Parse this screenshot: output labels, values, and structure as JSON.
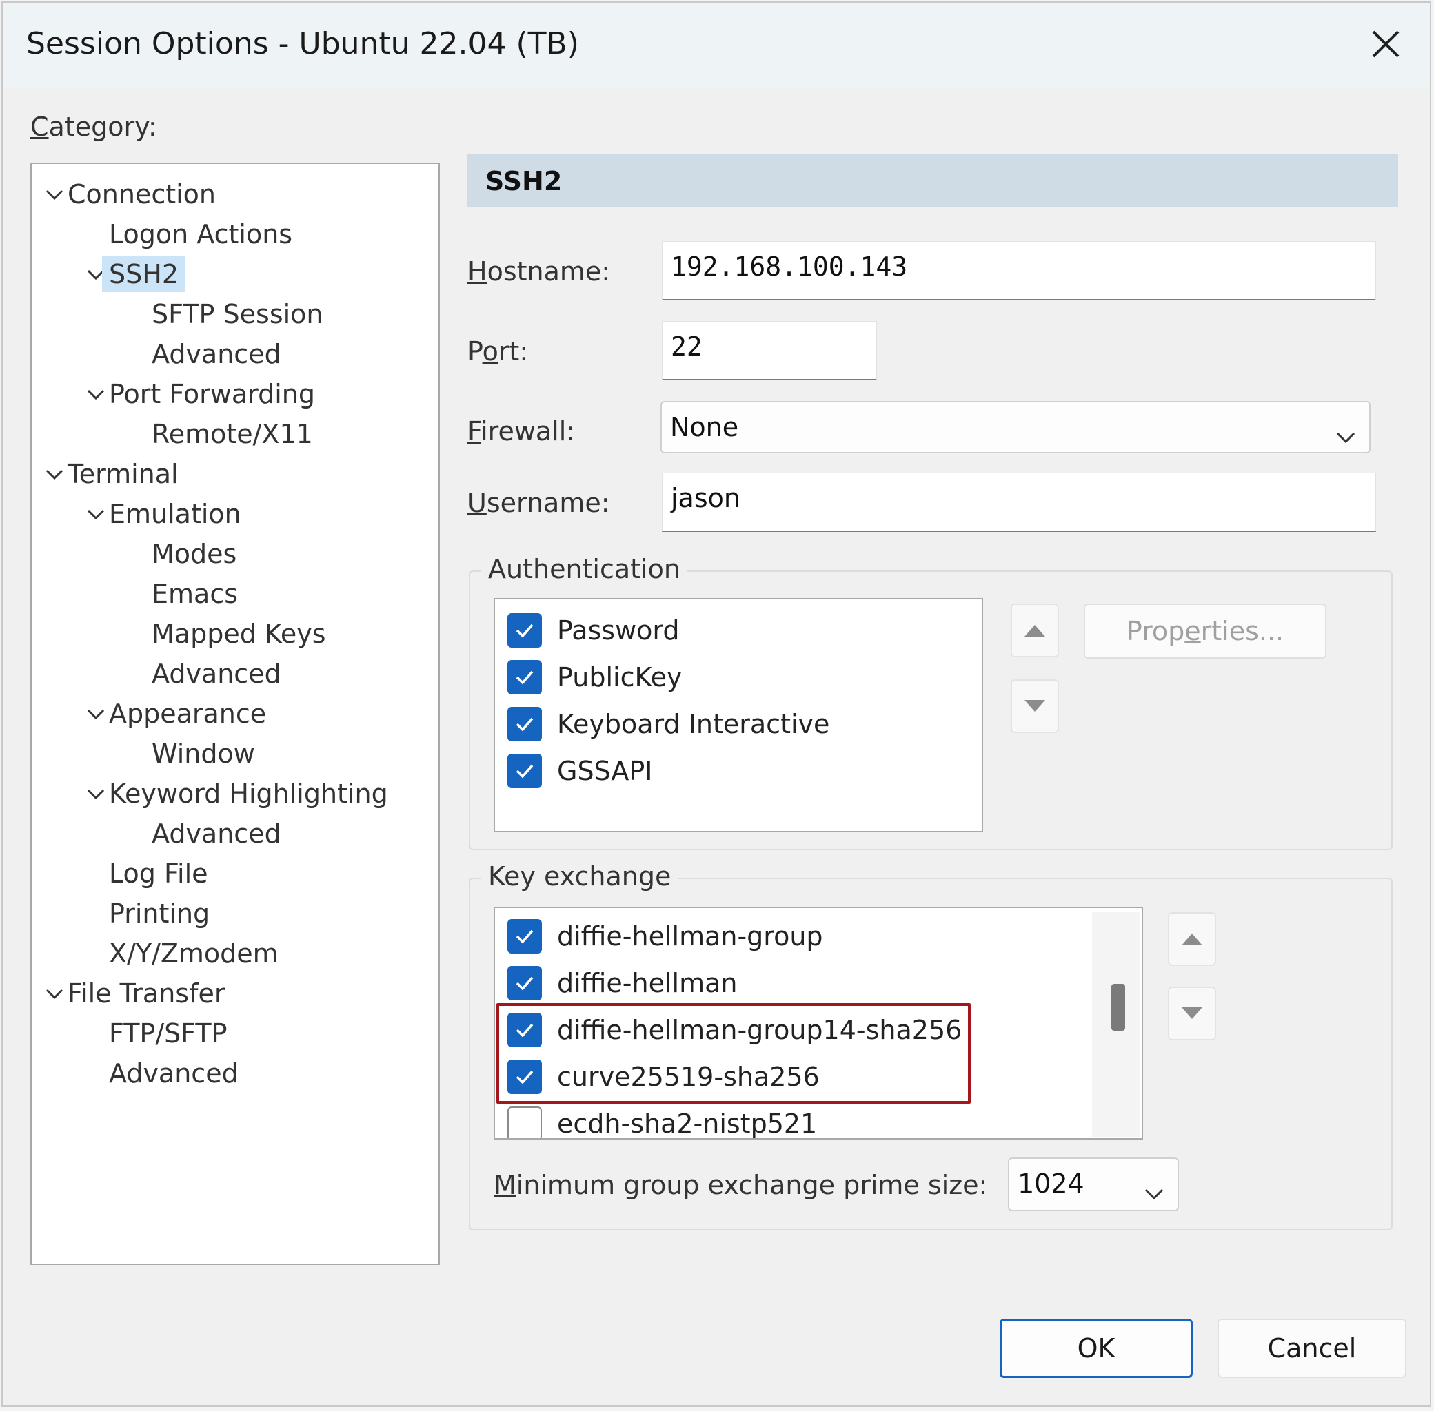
{
  "window": {
    "title": "Session Options - Ubuntu 22.04 (TB)"
  },
  "category": {
    "label_u": "C",
    "label_rest": "ategory:",
    "tree": [
      {
        "label": "Connection",
        "level": 0,
        "expanded": true
      },
      {
        "label": "Logon Actions",
        "level": 1
      },
      {
        "label": "SSH2",
        "level": 1,
        "expanded": true,
        "selected": true
      },
      {
        "label": "SFTP Session",
        "level": 2
      },
      {
        "label": "Advanced",
        "level": 2
      },
      {
        "label": "Port Forwarding",
        "level": 1,
        "expanded": true
      },
      {
        "label": "Remote/X11",
        "level": 2
      },
      {
        "label": "Terminal",
        "level": 0,
        "expanded": true
      },
      {
        "label": "Emulation",
        "level": 1,
        "expanded": true
      },
      {
        "label": "Modes",
        "level": 2
      },
      {
        "label": "Emacs",
        "level": 2
      },
      {
        "label": "Mapped Keys",
        "level": 2
      },
      {
        "label": "Advanced",
        "level": 2
      },
      {
        "label": "Appearance",
        "level": 1,
        "expanded": true
      },
      {
        "label": "Window",
        "level": 2
      },
      {
        "label": "Keyword Highlighting",
        "level": 1,
        "expanded": true
      },
      {
        "label": "Advanced",
        "level": 2
      },
      {
        "label": "Log File",
        "level": 1
      },
      {
        "label": "Printing",
        "level": 1
      },
      {
        "label": "X/Y/Zmodem",
        "level": 1
      },
      {
        "label": "File Transfer",
        "level": 0,
        "expanded": true
      },
      {
        "label": "FTP/SFTP",
        "level": 1
      },
      {
        "label": "Advanced",
        "level": 1
      }
    ]
  },
  "panel": {
    "title": "SSH2",
    "hostname": {
      "label_u": "H",
      "label_rest": "ostname:",
      "value": "192.168.100.143"
    },
    "port": {
      "label_pre": "P",
      "label_u": "o",
      "label_rest": "rt:",
      "value": "22"
    },
    "firewall": {
      "label_u": "F",
      "label_rest": "irewall:",
      "value": "None"
    },
    "username": {
      "label_u": "U",
      "label_rest": "sername:",
      "value": "jason"
    },
    "authentication": {
      "title": "Authentication",
      "items": [
        {
          "label": "Password",
          "checked": true
        },
        {
          "label": "PublicKey",
          "checked": true
        },
        {
          "label": "Keyboard Interactive",
          "checked": true
        },
        {
          "label": "GSSAPI",
          "checked": true
        }
      ],
      "properties_button": {
        "pre": "Prop",
        "u": "e",
        "rest": "rties..."
      }
    },
    "key_exchange": {
      "title": "Key exchange",
      "items": [
        {
          "label": "diffie-hellman-group",
          "checked": true
        },
        {
          "label": "diffie-hellman",
          "checked": true
        },
        {
          "label": "diffie-hellman-group14-sha256",
          "checked": true
        },
        {
          "label": "curve25519-sha256",
          "checked": true
        },
        {
          "label": "ecdh-sha2-nistp521",
          "checked": false
        }
      ],
      "min_prime": {
        "label_u": "M",
        "label_rest": "inimum group exchange prime size:",
        "value": "1024"
      }
    }
  },
  "buttons": {
    "ok": "OK",
    "cancel": "Cancel"
  },
  "colors": {
    "accent": "#1565c0",
    "highlight": "#a3161c",
    "header": "#cfdce6",
    "selection": "#cce4f7"
  }
}
